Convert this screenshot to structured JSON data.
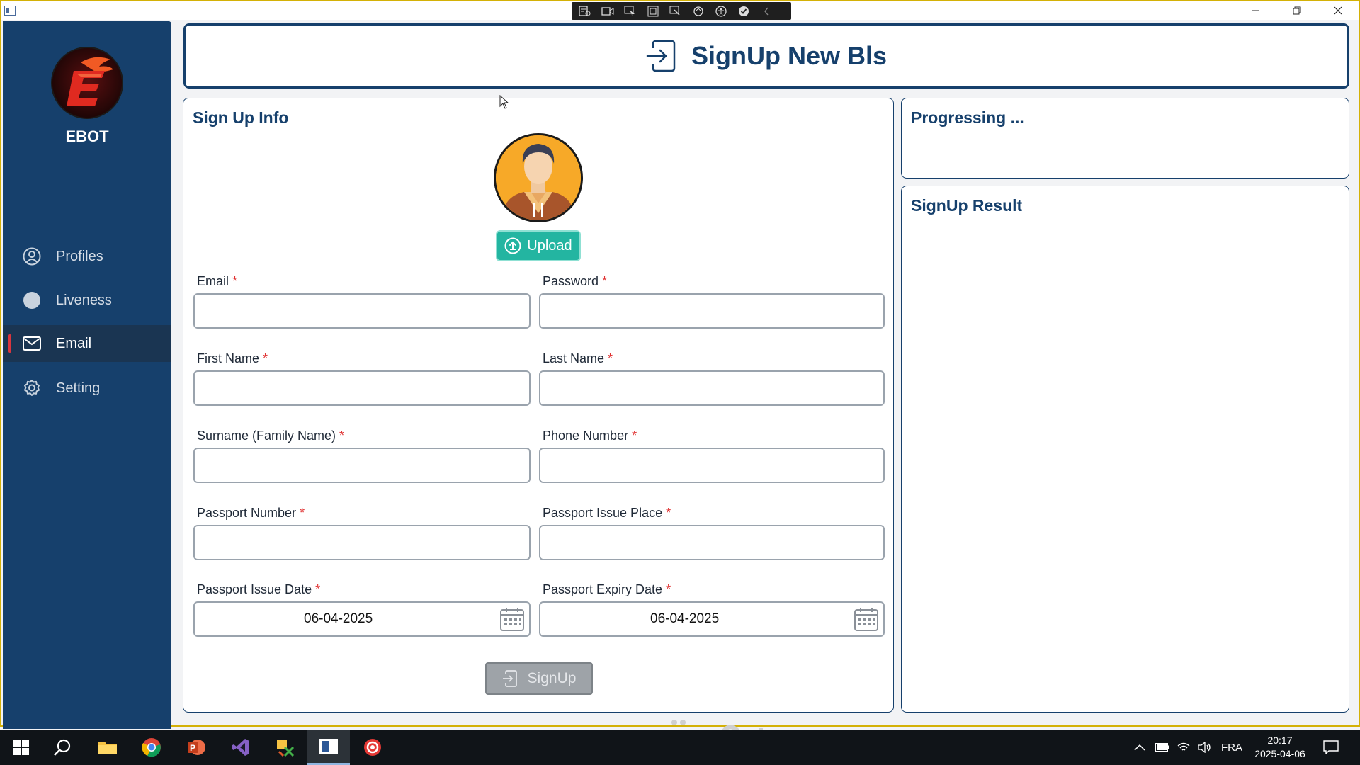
{
  "header": {
    "title": "SignUp New Bls"
  },
  "sidebar": {
    "brand": "EBOT",
    "items": [
      {
        "label": "Profiles",
        "icon": "user-circle-icon",
        "active": false
      },
      {
        "label": "Liveness",
        "icon": "circle-icon",
        "active": false
      },
      {
        "label": "Email",
        "icon": "mail-icon",
        "active": true
      },
      {
        "label": "Setting",
        "icon": "gear-icon",
        "active": false
      }
    ]
  },
  "signup": {
    "title": "Sign Up Info",
    "upload_label": "Upload",
    "required_mark": "*",
    "fields": {
      "email": {
        "label": "Email",
        "value": ""
      },
      "password": {
        "label": "Password",
        "value": ""
      },
      "first_name": {
        "label": "First Name",
        "value": ""
      },
      "last_name": {
        "label": "Last Name",
        "value": ""
      },
      "surname": {
        "label": "Surname (Family Name)",
        "value": ""
      },
      "phone": {
        "label": "Phone Number",
        "value": ""
      },
      "passport_number": {
        "label": "Passport Number",
        "value": ""
      },
      "passport_place": {
        "label": "Passport Issue Place",
        "value": ""
      },
      "passport_issue_date": {
        "label": "Passport Issue Date",
        "value": "06-04-2025"
      },
      "passport_expiry_date": {
        "label": "Passport Expiry Date",
        "value": "06-04-2025"
      }
    },
    "submit_label": "SignUp"
  },
  "progress": {
    "title": "Progressing ..."
  },
  "result": {
    "title": "SignUp Result"
  },
  "taskbar": {
    "language": "FRA",
    "time": "20:17",
    "date": "2025-04-06"
  },
  "colors": {
    "primary": "#16406c",
    "accent_teal": "#23b5a1",
    "required": "#e03131",
    "active_indicator": "#d9363e"
  }
}
